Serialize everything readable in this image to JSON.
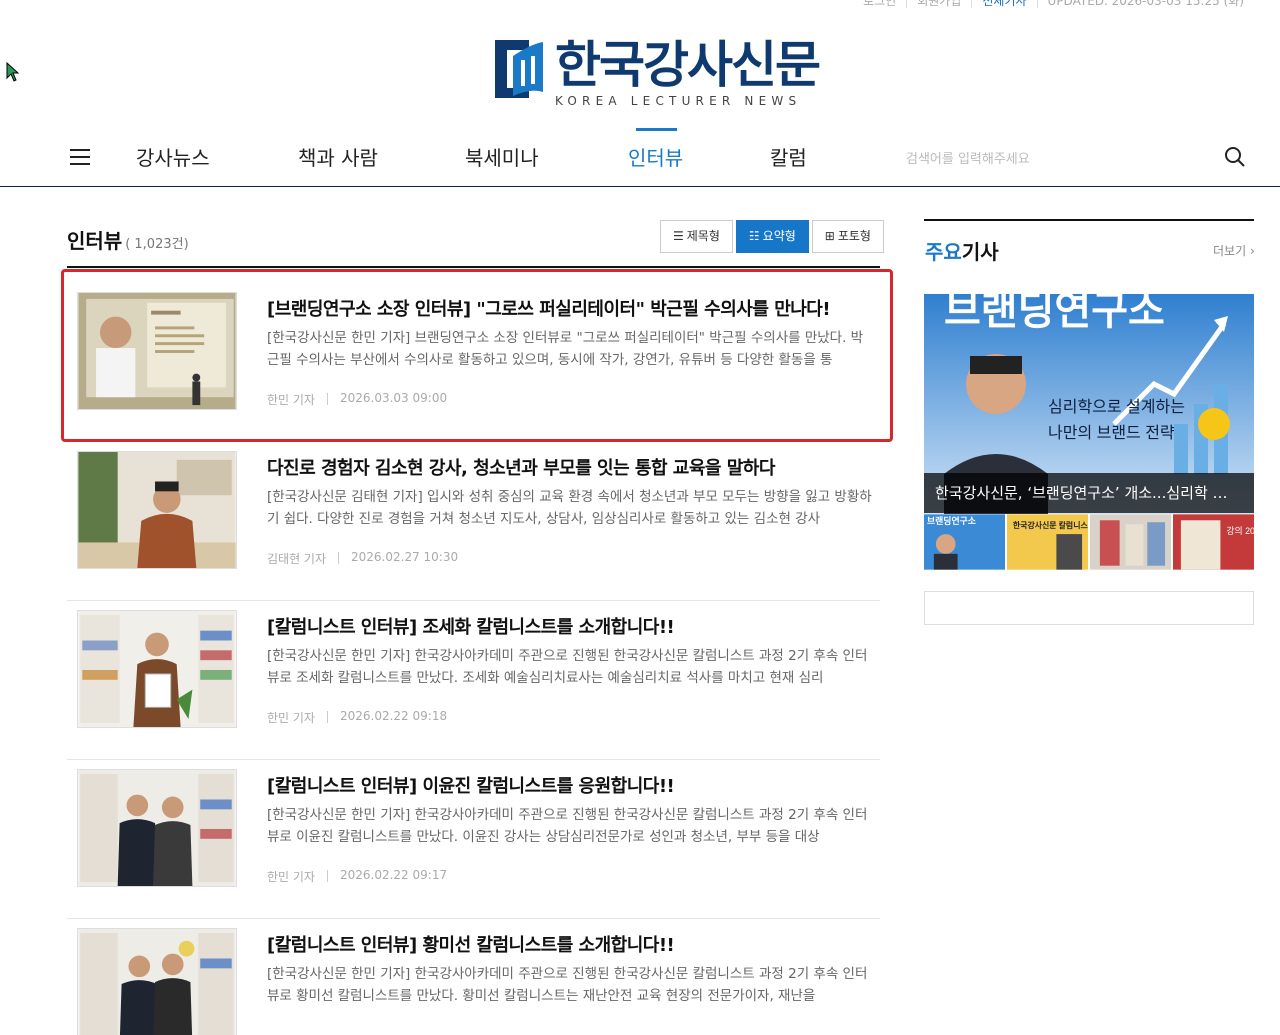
{
  "util": {
    "login": "로그인",
    "join": "회원가입",
    "all_articles": "전체기사",
    "updated": "UPDATED. 2026-03-03 15:25 (화)"
  },
  "logo": {
    "korean": "한국강사신문",
    "english": "KOREA LECTURER NEWS"
  },
  "nav": {
    "items": [
      {
        "label": "강사뉴스"
      },
      {
        "label": "책과 사람"
      },
      {
        "label": "북세미나"
      },
      {
        "label": "인터뷰"
      },
      {
        "label": "칼럼"
      }
    ],
    "active_index": 3,
    "search_placeholder": "검색어를 입력해주세요"
  },
  "list": {
    "title": "인터뷰",
    "count": "( 1,023건)",
    "view_buttons": [
      "제목형",
      "요약형",
      "포토형"
    ],
    "active_view": "요약형"
  },
  "articles": [
    {
      "title": "[브랜딩연구소 소장 인터뷰] \"그로쓰 퍼실리테이터\" 박근필 수의사를 만나다!",
      "summary": "[한국강사신문 한민 기자] 브랜딩연구소 소장 인터뷰로 \"그로쓰 퍼실리테이터\" 박근필 수의사를 만났다. 박근필 수의사는 부산에서 수의사로 활동하고 있으며, 동시에 작가, 강연가, 유튜버 등 다양한 활동을 통",
      "author": "한민 기자",
      "date": "2026.03.03 09:00"
    },
    {
      "title": "다진로 경험자 김소현 강사, 청소년과 부모를 잇는 통합 교육을 말하다",
      "summary": "[한국강사신문 김태현 기자] 입시와 성취 중심의 교육 환경 속에서 청소년과 부모 모두는 방향을 잃고 방황하기 쉽다. 다양한 진로 경험을 거쳐 청소년 지도사, 상담사, 임상심리사로 활동하고 있는 김소현 강사",
      "author": "김태현 기자",
      "date": "2026.02.27 10:30"
    },
    {
      "title": "[칼럼니스트 인터뷰] 조세화 칼럼니스트를 소개합니다!!",
      "summary": "[한국강사신문 한민 기자] 한국강사아카데미 주관으로 진행된 한국강사신문 칼럼니스트 과정 2기 후속 인터뷰로 조세화 칼럼니스트를 만났다. 조세화 예술심리치료사는 예술심리치료 석사를 마치고 현재 심리",
      "author": "한민 기자",
      "date": "2026.02.22 09:18"
    },
    {
      "title": "[칼럼니스트 인터뷰] 이윤진 칼럼니스트를 응원합니다!!",
      "summary": "[한국강사신문 한민 기자] 한국강사아카데미 주관으로 진행된 한국강사신문 칼럼니스트 과정 2기 후속 인터뷰로 이윤진 칼럼니스트를 만났다. 이윤진 강사는 상담심리전문가로 성인과 청소년, 부부 등을 대상",
      "author": "한민 기자",
      "date": "2026.02.22 09:17"
    },
    {
      "title": "[칼럼니스트 인터뷰] 황미선 칼럼니스트를 소개합니다!!",
      "summary": "[한국강사신문 한민 기자] 한국강사아카데미 주관으로 진행된 한국강사신문 칼럼니스트 과정 2기 후속 인터뷰로 황미선 칼럼니스트를 만났다. 황미선 칼럼니스트는 재난안전 교육 현장의 전문가이자, 재난을",
      "author": "한민 기자",
      "date": ""
    }
  ],
  "sidebar": {
    "title_highlight": "주요",
    "title_rest": "기사",
    "more": "더보기",
    "feature_caption": "한국강사신문, ‘브랜딩연구소’ 개소...심리학 …",
    "feature_banner_title": "브랜딩연구소",
    "feature_banner_line1": "심리학으로 설계하는",
    "feature_banner_line2": "나만의 브랜드 전략",
    "mini_captions": [
      "브랜딩연구소",
      "한국강사신문 칼럼니스트 과정",
      "",
      "강의 2026"
    ]
  },
  "colors": {
    "accent": "#1a7ac8",
    "navy": "#0f3a70",
    "highlight_border": "#d9262b"
  }
}
